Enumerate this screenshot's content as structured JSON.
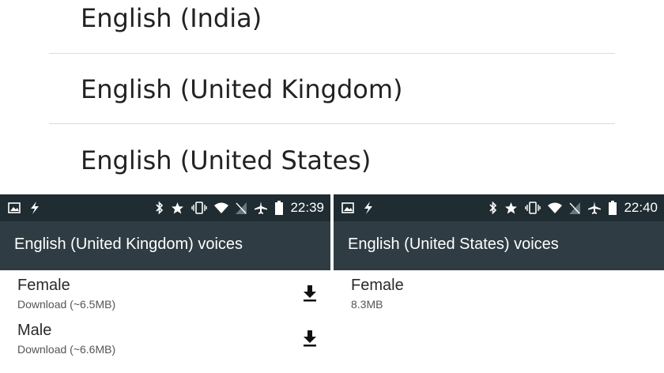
{
  "language_list": {
    "items": [
      "English (India)",
      "English (United Kingdom)",
      "English (United States)"
    ]
  },
  "left_panel": {
    "status_time": "22:39",
    "title": "English (United Kingdom) voices",
    "voices": [
      {
        "name": "Female",
        "detail": "Download (~6.5MB)",
        "action_icon": "download-icon"
      },
      {
        "name": "Male",
        "detail": "Download (~6.6MB)",
        "action_icon": "download-icon"
      }
    ]
  },
  "right_panel": {
    "status_time": "22:40",
    "title": "English (United States) voices",
    "voices": [
      {
        "name": "Female",
        "detail": "8.3MB"
      }
    ]
  },
  "status_icons": [
    "image-icon",
    "flash-icon",
    "bluetooth-icon",
    "star-icon",
    "vibrate-icon",
    "wifi-icon",
    "no-sim-icon",
    "airplane-icon",
    "battery-icon"
  ],
  "colors": {
    "statusbar": "#1f2c32",
    "appbar": "#2f3c43",
    "text": "#222222"
  }
}
